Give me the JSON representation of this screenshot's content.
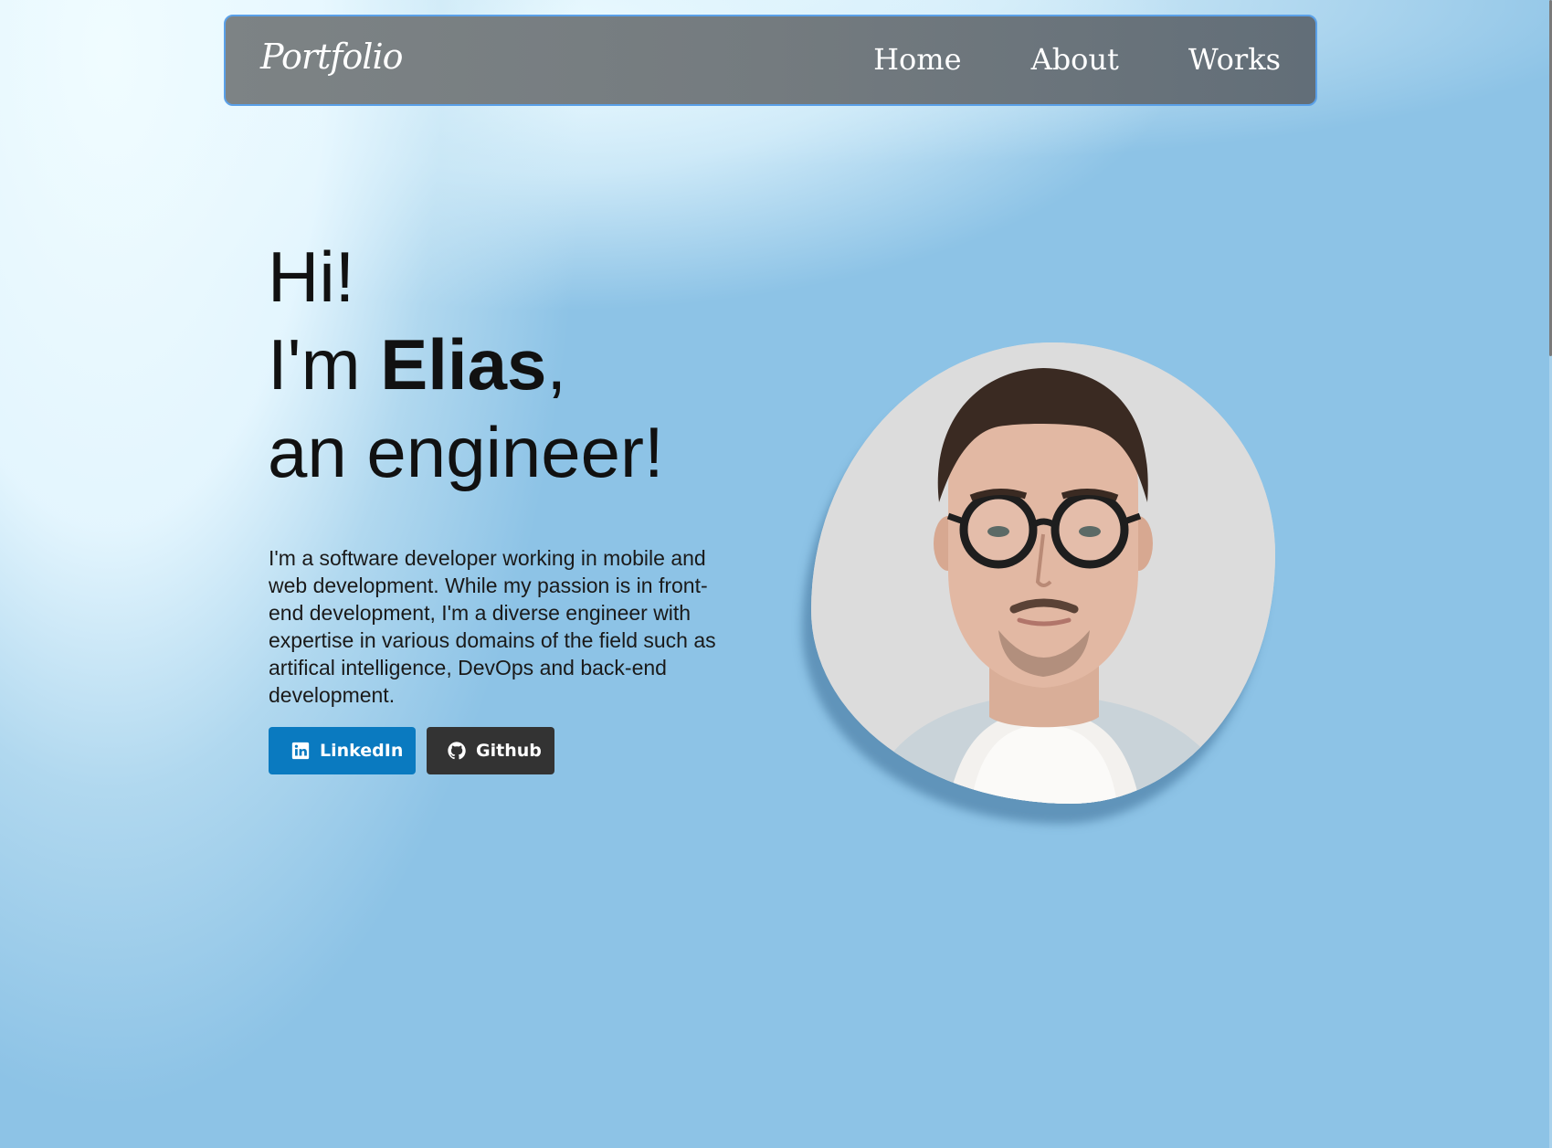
{
  "navbar": {
    "brand": "Portfolio",
    "links": [
      {
        "label": "Home"
      },
      {
        "label": "About"
      },
      {
        "label": "Works"
      }
    ]
  },
  "hero": {
    "greeting": "Hi!",
    "intro_prefix": "I'm ",
    "name": "Elias",
    "intro_suffix": ",",
    "role_line": "an engineer!",
    "description": "I'm a software developer working in mobile and web development. While my passion is in front-end development, I'm a diverse engineer with expertise in various domains of the field such as artifical intelligence, DevOps and back-end development.",
    "buttons": [
      {
        "label": "LinkedIn",
        "icon": "linkedin-icon"
      },
      {
        "label": "Github",
        "icon": "github-icon"
      }
    ]
  },
  "colors": {
    "background": "#8dc3e6",
    "navbar_border": "#5aa0e8",
    "linkedin": "#0a7ac0",
    "github": "#333333"
  }
}
